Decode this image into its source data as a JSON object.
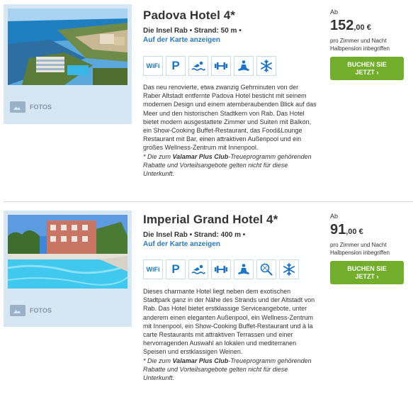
{
  "hotels": [
    {
      "name": "Padova Hotel 4*",
      "location": "Die Insel Rab",
      "beach": "Strand: 50 m",
      "map_link": "Auf der Karte anzeigen",
      "photos_label": "FOTOS",
      "amenities": [
        "wifi-icon",
        "parking-icon",
        "swimming-icon",
        "fitness-icon",
        "wellness-icon",
        "air-conditioning-icon"
      ],
      "wifi_text": "WiFi",
      "parking_text": "P",
      "description": "Das neu renovierte, etwa zwanzig Gehminuten von der Raber Altstadt entfernte Padova Hotel besticht mit seinem modernen Design und einem atemberaubenden Blick auf das Meer und den historischen Stadtkern von Rab. Das Hotel bietet modern ausgestattete Zimmer und Suiten mit Balkon, ein Show-Cooking Buffet-Restaurant, das Food&Lounge Restaurant mit Bar, einen attraktiven Außenpool und ein großes Wellness-Zentrum mit Innenpool.",
      "note_prefix": "* Die zum ",
      "note_club": "Valamar Plus Club",
      "note_suffix": "-Treueprogramm gehörenden Rabatte und Vorteilsangebote gelten nicht für diese Unterkunft.",
      "price_from": "Ab",
      "price_main": "152",
      "price_cents": ",00 €",
      "price_note": "pro Zimmer und Nacht Halbpension inbegriffen",
      "book_label": "BUCHEN SIE JETZT ›"
    },
    {
      "name": "Imperial Grand Hotel 4*",
      "location": "Die Insel Rab",
      "beach": "Strand: 400 m",
      "map_link": "Auf der Karte anzeigen",
      "photos_label": "FOTOS",
      "amenities": [
        "wifi-icon",
        "parking-icon",
        "swimming-icon",
        "fitness-icon",
        "wellness-icon",
        "tennis-icon",
        "air-conditioning-icon"
      ],
      "wifi_text": "WiFi",
      "parking_text": "P",
      "description": "Dieses charmante Hotel liegt neben dem exotischen Stadtpark ganz in der Nähe des Strands und der Altstadt von Rab. Das Hotel bietet erstklassige Serviceangebote, unter anderem einen eleganten Außenpool, ein Wellness-Zentrum mit Innenpool, ein Show-Cooking Buffet-Restaurant und à la carte Restaurants mit attraktiven Terrassen und einer hervorragenden Auswahl an lokalen und mediterranen Speisen und erstklassigen Weinen.",
      "note_prefix": "* Die zum ",
      "note_club": "Valamar Plus Club",
      "note_suffix": "-Treueprogramm gehörenden Rabatte und Vorteilsangebote gelten nicht für diese Unterkunft.",
      "price_from": "Ab",
      "price_main": "91",
      "price_cents": ",00 €",
      "price_note": "pro Zimmer und Nacht Halbpension inbegriffen",
      "book_label": "BUCHEN SIE JETZT ›"
    }
  ],
  "colors": {
    "accent_blue": "#1b75c6",
    "link_blue": "#2b78c5",
    "book_green": "#72ad2b",
    "media_bg": "#d7e6f3"
  }
}
